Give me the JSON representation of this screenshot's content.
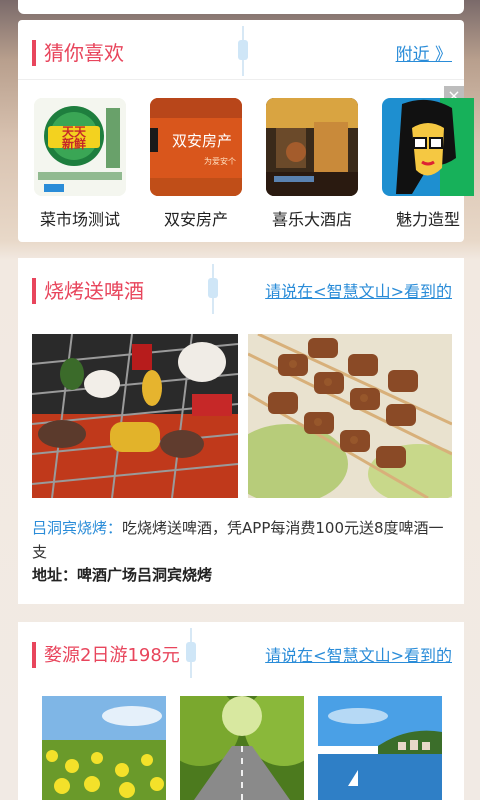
{
  "guess": {
    "title": "猜你喜欢",
    "link": "附近 》",
    "close": "×",
    "items": [
      {
        "name": "菜市场测试",
        "logo_lines": [
          "天天",
          "新鲜"
        ]
      },
      {
        "name": "双安房产",
        "sign": "双安房产",
        "sub": "为爱安个"
      },
      {
        "name": "喜乐大酒店"
      },
      {
        "name": "魅力造型"
      }
    ]
  },
  "bbq": {
    "title": "烧烤送啤酒",
    "link": "请说在<智慧文山>看到的",
    "shop": "吕洞宾烧烤：",
    "desc": "吃烧烤送啤酒，凭APP每消费100元送8度啤酒一支",
    "address": "地址：啤酒广场吕洞宾烧烤"
  },
  "trip": {
    "title": "婺源2日游198元",
    "link": "请说在<智慧文山>看到的"
  }
}
